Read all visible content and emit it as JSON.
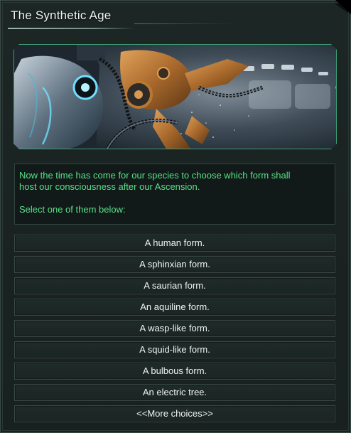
{
  "window": {
    "title": "The Synthetic Age"
  },
  "event": {
    "description_line1": "Now the time has come for our species to choose which form shall",
    "description_line2": "host our consciousness after our Ascension.",
    "prompt": "Select one of them below:"
  },
  "options": [
    {
      "label": "A human form."
    },
    {
      "label": "A sphinxian form."
    },
    {
      "label": "A saurian form."
    },
    {
      "label": "An aquiline form."
    },
    {
      "label": "A wasp-like form."
    },
    {
      "label": "A squid-like form."
    },
    {
      "label": "A bulbous form."
    },
    {
      "label": "An electric tree."
    },
    {
      "label": "<<More choices>>"
    }
  ],
  "colors": {
    "frame_accent": "#3e9e74",
    "description_text": "#58e088",
    "button_text": "#eef2f0"
  }
}
